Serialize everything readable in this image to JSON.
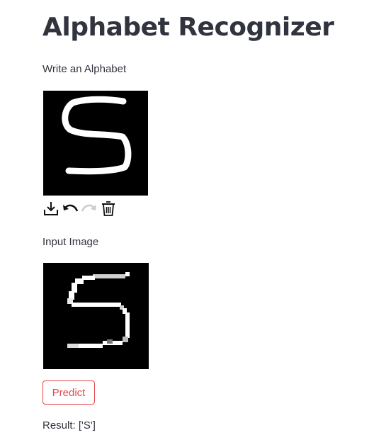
{
  "app": {
    "title": "Alphabet Recognizer"
  },
  "canvas": {
    "label": "Write an Alphabet",
    "background": "#000000",
    "stroke_color": "#ffffff"
  },
  "toolbar": {
    "items": [
      {
        "icon": "download-icon"
      },
      {
        "icon": "undo-icon"
      },
      {
        "icon": "redo-icon",
        "disabled": true
      },
      {
        "icon": "trash-icon"
      }
    ]
  },
  "input_image": {
    "label": "Input Image"
  },
  "predict": {
    "label": "Predict",
    "accent": "#e5484d"
  },
  "result": {
    "text": "Result: ['S']"
  }
}
